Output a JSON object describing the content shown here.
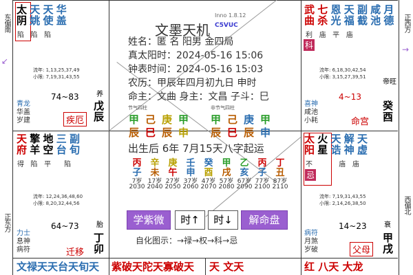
{
  "app": {
    "title": "文墨天机",
    "version": "Inno 1.8.12",
    "code": "C5VUC"
  },
  "sides": {
    "left_top": "东偏南",
    "left_mid": "正东方",
    "right_top": "正西方",
    "right_mid": "西偏北"
  },
  "palaces": {
    "top_left": {
      "stars": [
        "太阴",
        "天姚",
        "天使",
        "华盖"
      ],
      "status": [
        "陷",
        "陷",
        "陷",
        ""
      ]
    },
    "top_right": {
      "stars": [
        "武曲",
        "七杀",
        "恩光",
        "天福",
        "副截",
        "咸池",
        "月德"
      ],
      "status": [
        "利",
        "庙",
        "平",
        "庙",
        "",
        "",
        ""
      ],
      "hua": "科"
    },
    "jie": {
      "flow": "流年: 1,13,25,37,49",
      "minor": "小限: 7,19,31,43,55",
      "gods": [
        "青龙",
        "华盖",
        "岁建"
      ],
      "age": "74~83",
      "name": "疾厄",
      "changsheng": "养",
      "stem": "戊辰"
    },
    "ming": {
      "flow": "流年: 6,18,30,42,54",
      "minor": "小限: 3,15,27,39,51",
      "gods": [
        "喜神",
        "咸池",
        "小耗"
      ],
      "age": "4~13",
      "name": "命宫",
      "changsheng": "帝旺",
      "stem": "癸酉"
    },
    "mid_left": {
      "stars": [
        "天府",
        "擎羊",
        "地空",
        "三台",
        "副旬"
      ],
      "status": [
        "得",
        "陷",
        "平",
        "",
        "陷"
      ]
    },
    "mid_right": {
      "stars": [
        "太阳",
        "火星",
        "天诰",
        "解神",
        "天虚"
      ],
      "status": [
        "不",
        "",
        "",
        "庙",
        "庙"
      ],
      "hua": "忌"
    },
    "qian": {
      "flow": "流年: 12,24,36,48,60",
      "minor": "小限: 8,20,32,44,56",
      "gods": [
        "力士",
        "息神",
        "病符"
      ],
      "age": "64~73",
      "name": "迁移",
      "changsheng": "胎",
      "stem": "丁卯"
    },
    "fu": {
      "flow": "流年: 7,19,31,43,55",
      "minor": "小限: 2,14,26,38,50",
      "gods": [
        "病符",
        "月煞",
        "岁破"
      ],
      "age": "14~23",
      "name": "父母",
      "changsheng": "衰",
      "stem": "甲戌"
    },
    "bottom_row": [
      "文禄天天台天旬天",
      "紫破天陀天寡破天",
      "天 文天",
      "红 八天 大龙"
    ]
  },
  "center": {
    "name_line": "姓名：匿 名         阳男 金四局",
    "solar_line": "真太阳时：2024-05-16 15:06",
    "clock_line": "钟表时间：2024-05-16 15:03",
    "lunar_line": "农历：甲辰年四月初九日 申时",
    "ming_line": "命主：文曲 身主：文昌 子斗：巳",
    "pillar_hdr1": "节气四柱",
    "pillar_hdr2": "非节气四柱",
    "pillars1": [
      [
        "甲",
        "辰"
      ],
      [
        "己",
        "巳"
      ],
      [
        "庚",
        "辰"
      ],
      [
        "甲",
        "申"
      ]
    ],
    "pillars2": [
      [
        "甲",
        "辰"
      ],
      [
        "己",
        "巳"
      ],
      [
        "庚",
        "辰"
      ],
      [
        "甲",
        "申"
      ]
    ],
    "birth_line": "出生后 6年 7月15天八字起运",
    "dayun_stems": [
      "丙",
      "辛",
      "庚",
      "壬",
      "癸",
      "甲",
      "乙",
      "丙",
      "丁"
    ],
    "dayun_branches": [
      "子",
      "未",
      "午",
      "申",
      "酉",
      "戌",
      "亥",
      "子",
      "丑"
    ],
    "dayun_ages": [
      "7岁",
      "17岁",
      "27岁",
      "37岁",
      "47岁",
      "57岁",
      "67岁",
      "77岁",
      "87岁"
    ],
    "dayun_years": [
      "2030",
      "2040",
      "2050",
      "2060",
      "2070",
      "2080",
      "2090",
      "2100",
      "2110"
    ],
    "buttons": {
      "learn": "学紫微",
      "prev": "时↑",
      "next": "时↓",
      "solve": "解命盘"
    },
    "legend": "自化图示：→禄→权→科→忌"
  }
}
